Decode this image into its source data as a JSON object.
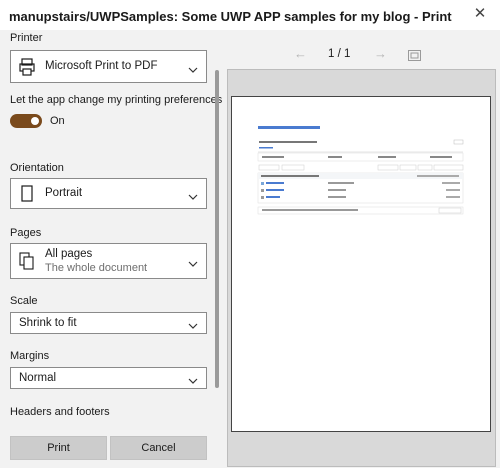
{
  "window": {
    "title": "manupstairs/UWPSamples: Some UWP APP samples for my blog - Print",
    "close_glyph": "✕"
  },
  "printer": {
    "label": "Printer",
    "value": "Microsoft Print to PDF",
    "icon": "printer-icon"
  },
  "preferences": {
    "label": "Let the app change my printing preferences",
    "toggle_state": "On"
  },
  "orientation": {
    "label": "Orientation",
    "value": "Portrait",
    "icon": "portrait-page-icon"
  },
  "pages": {
    "label": "Pages",
    "value": "All pages",
    "sub": "The whole document",
    "icon": "pages-icon"
  },
  "scale": {
    "label": "Scale",
    "value": "Shrink to fit"
  },
  "margins": {
    "label": "Margins",
    "value": "Normal"
  },
  "headers": {
    "label": "Headers and footers"
  },
  "buttons": {
    "print": "Print",
    "cancel": "Cancel"
  },
  "preview": {
    "page_count": "1 / 1",
    "prev_glyph": "←",
    "next_glyph": "→"
  },
  "colors": {
    "toggle_on": "#7a4a1c",
    "pane_bg": "#f2f2f2",
    "button_bg": "#cccccc"
  }
}
